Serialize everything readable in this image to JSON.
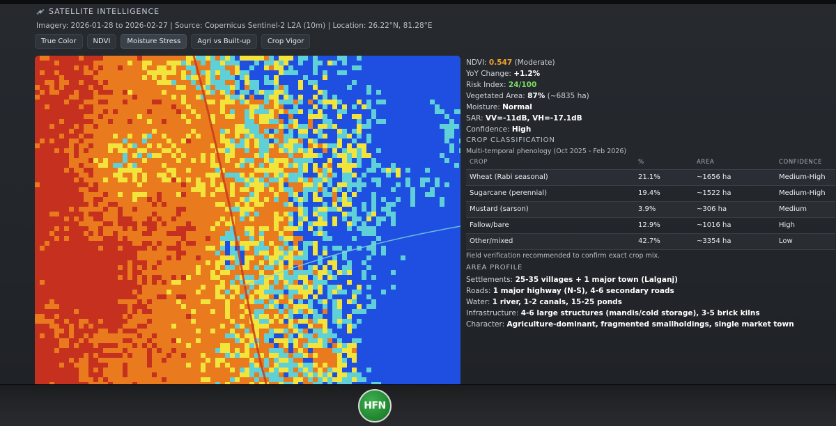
{
  "header": {
    "title": "SATELLITE INTELLIGENCE",
    "imagery_meta": "Imagery: 2026-01-28 to 2026-02-27 | Source: Copernicus Sentinel-2 L2A (10m) | Location: 26.22°N, 81.28°E"
  },
  "tabs": [
    {
      "label": "True Color"
    },
    {
      "label": "NDVI"
    },
    {
      "label": "Moisture Stress",
      "active": true
    },
    {
      "label": "Agri vs Built-up"
    },
    {
      "label": "Crop Vigor"
    }
  ],
  "map": {
    "icon": "moisture-stress-map",
    "colors": {
      "high": "#1f4fe0",
      "mid": "#5fd0d8",
      "low": "#f2e43a",
      "dry": "#ea7a1e",
      "severe": "#c6301e"
    }
  },
  "stats": {
    "ndvi_label": "NDVI:",
    "ndvi_value": "0.547",
    "ndvi_class": "(Moderate)",
    "yoy_label": "YoY Change:",
    "yoy_value": "+1.2%",
    "risk_label": "Risk Index:",
    "risk_value": "24/100",
    "veg_label": "Vegetated Area:",
    "veg_value": "87%",
    "veg_area": "(~6835 ha)",
    "moisture_label": "Moisture:",
    "moisture_value": "Normal",
    "sar_label": "SAR:",
    "sar_value": "VV=-11dB, VH=-17.1dB",
    "confidence_label": "Confidence:",
    "confidence_value": "High"
  },
  "crop_classification": {
    "heading": "CROP CLASSIFICATION",
    "subtitle": "Multi-temporal phenology (Oct 2025 - Feb 2026)",
    "columns": [
      "CROP",
      "%",
      "AREA",
      "CONFIDENCE"
    ],
    "rows": [
      [
        "Wheat (Rabi seasonal)",
        "21.1%",
        "~1656 ha",
        "Medium-High"
      ],
      [
        "Sugarcane (perennial)",
        "19.4%",
        "~1522 ha",
        "Medium-High"
      ],
      [
        "Mustard (sarson)",
        "3.9%",
        "~306 ha",
        "Medium"
      ],
      [
        "Fallow/bare",
        "12.9%",
        "~1016 ha",
        "High"
      ],
      [
        "Other/mixed",
        "42.7%",
        "~3354 ha",
        "Low"
      ]
    ],
    "note": "Field verification recommended to confirm exact crop mix."
  },
  "area_profile": {
    "heading": "AREA PROFILE",
    "settlements_label": "Settlements:",
    "settlements_value": "25-35 villages + 1 major town (Lalganj)",
    "roads_label": "Roads:",
    "roads_value": "1 major highway (N-S), 4-6 secondary roads",
    "water_label": "Water:",
    "water_value": "1 river, 1-2 canals, 15-25 ponds",
    "infra_label": "Infrastructure:",
    "infra_value": "4-6 large structures (mandis/cold storage), 3-5 brick kilns",
    "character_label": "Character:",
    "character_value": "Agriculture-dominant, fragmented smallholdings, single market town"
  },
  "monitor": {
    "logo_text": "HFN"
  }
}
